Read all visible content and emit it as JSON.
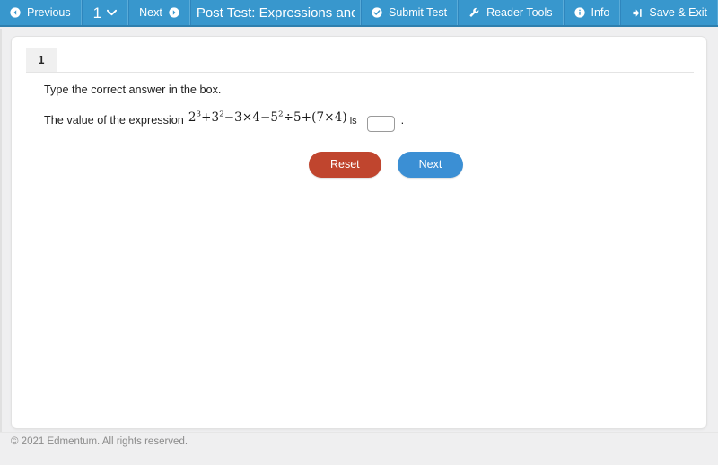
{
  "toolbar": {
    "previous_label": "Previous",
    "previous_icon": "circle-arrow-left-icon",
    "page_number": "1",
    "page_dropdown_icon": "chevron-down-icon",
    "next_label": "Next",
    "next_icon": "circle-arrow-right-icon",
    "title": "Post Test: Expressions and Equ",
    "submit_label": "Submit Test",
    "submit_icon": "check-circle-icon",
    "reader_tools_label": "Reader Tools",
    "reader_tools_icon": "wrench-icon",
    "info_label": "Info",
    "info_icon": "info-circle-icon",
    "save_exit_label": "Save & Exit",
    "save_exit_icon": "sign-out-icon",
    "background_color": "#3897cd"
  },
  "question": {
    "number": "1",
    "prompt": "Type the correct answer in the box.",
    "sentence_prefix": "The value of the expression",
    "expression": {
      "plain": "2^3+3^2-3×4-5^2÷5+(7×4)",
      "parts": [
        {
          "base": "2",
          "exp": "3"
        },
        {
          "op": "+"
        },
        {
          "base": "3",
          "exp": "2"
        },
        {
          "op": "−"
        },
        {
          "base": "3"
        },
        {
          "op": "×"
        },
        {
          "base": "4"
        },
        {
          "op": "−"
        },
        {
          "base": "5",
          "exp": "2"
        },
        {
          "op": "÷"
        },
        {
          "base": "5"
        },
        {
          "op": "+"
        },
        {
          "base": "(7×4)"
        }
      ]
    },
    "sentence_middle": "is",
    "answer_value": "",
    "answer_placeholder": "",
    "sentence_suffix": "."
  },
  "buttons": {
    "reset_label": "Reset",
    "reset_color": "#c0452e",
    "next_label": "Next",
    "next_color": "#3b8fd4"
  },
  "footer": {
    "copyright": "© 2021 Edmentum. All rights reserved."
  }
}
